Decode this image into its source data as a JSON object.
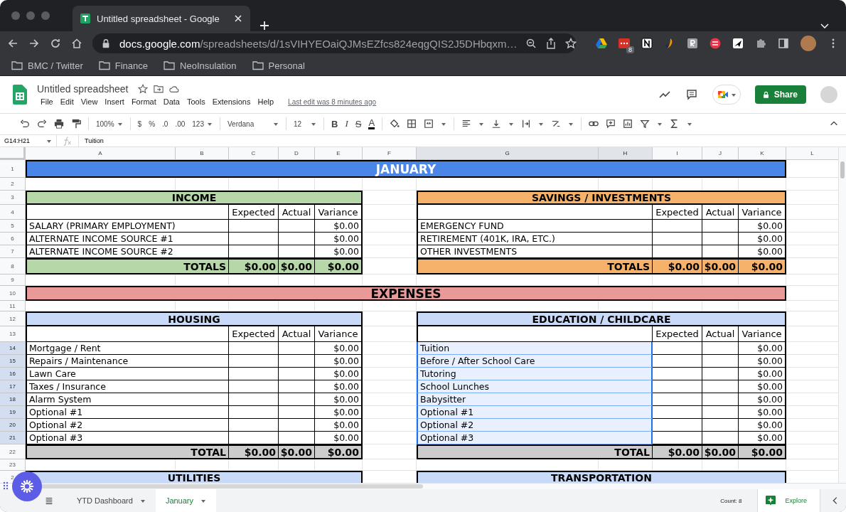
{
  "browser": {
    "tabs": [
      {
        "title": "Untitled spreadsheet - Google",
        "selected": true
      }
    ],
    "url": {
      "domain": "docs.google.com",
      "path": "/spreadsheets/d/1sVIHYEOaiQJMsEZfcs824eqgQIS2J5DHbqxm…"
    },
    "extension_badge": "8",
    "bookmarks": [
      "BMC / Twitter",
      "Finance",
      "NeoInsulation",
      "Personal"
    ]
  },
  "app": {
    "title": "Untitled spreadsheet",
    "menu": [
      "File",
      "Edit",
      "View",
      "Insert",
      "Format",
      "Data",
      "Tools",
      "Extensions",
      "Help"
    ],
    "last_edit": "Last edit was 8 minutes ago",
    "share": "Share"
  },
  "toolbar": {
    "zoom": "100%",
    "currency": "$",
    "percent": "%",
    "decrease_decimals": ".0",
    "increase_decimals": ".00",
    "more_formats": "123",
    "font": "Verdana",
    "font_size": "12",
    "bold": "B",
    "italic": "I",
    "strikethrough": "S",
    "text_color": "A"
  },
  "formula_bar": {
    "name_box": "G14:H21",
    "formula": "Tuition"
  },
  "sheet": {
    "columns": [
      {
        "label": "A",
        "selected": false
      },
      {
        "label": "B",
        "selected": false
      },
      {
        "label": "C",
        "selected": false
      },
      {
        "label": "D",
        "selected": false
      },
      {
        "label": "E",
        "selected": false
      },
      {
        "label": "F",
        "selected": false
      },
      {
        "label": "G",
        "selected": true
      },
      {
        "label": "H",
        "selected": true
      },
      {
        "label": "I",
        "selected": false
      },
      {
        "label": "J",
        "selected": false
      },
      {
        "label": "K",
        "selected": false
      },
      {
        "label": "L",
        "selected": false
      }
    ],
    "rows": [
      {
        "label": "1",
        "selected": false
      },
      {
        "label": "2",
        "selected": false
      },
      {
        "label": "3",
        "selected": false
      },
      {
        "label": "4",
        "selected": false
      },
      {
        "label": "5",
        "selected": false
      },
      {
        "label": "6",
        "selected": false
      },
      {
        "label": "7",
        "selected": false
      },
      {
        "label": "8",
        "selected": false
      },
      {
        "label": "9",
        "selected": false
      },
      {
        "label": "10",
        "selected": false
      },
      {
        "label": "11",
        "selected": false
      },
      {
        "label": "12",
        "selected": false
      },
      {
        "label": "13",
        "selected": false
      },
      {
        "label": "14",
        "selected": true
      },
      {
        "label": "15",
        "selected": true
      },
      {
        "label": "16",
        "selected": true
      },
      {
        "label": "17",
        "selected": true
      },
      {
        "label": "18",
        "selected": true
      },
      {
        "label": "19",
        "selected": true
      },
      {
        "label": "20",
        "selected": true
      },
      {
        "label": "21",
        "selected": true
      },
      {
        "label": "22",
        "selected": false
      },
      {
        "label": "23",
        "selected": false
      },
      {
        "label": "2",
        "selected": false
      }
    ],
    "blocks": [
      {
        "kind": "banner",
        "text": "JANUARY",
        "color": "#4a86e8"
      },
      {
        "kind": "pair",
        "tables": [
          {
            "title": "INCOME",
            "color": "#b6d7a8",
            "columns": [
              "Expected",
              "Actual",
              "Variance"
            ],
            "items": [
              {
                "label": "SALARY (PRIMARY EMPLOYMENT)",
                "variance": "$0.00",
                "selected": false
              },
              {
                "label": "ALTERNATE INCOME SOURCE #1",
                "variance": "$0.00",
                "selected": false
              },
              {
                "label": "ALTERNATE INCOME SOURCE #2",
                "variance": "$0.00",
                "selected": false
              }
            ],
            "total": {
              "label": "TOTALS",
              "color": "#b6d7a8",
              "values": [
                "$0.00",
                "$0.00",
                "$0.00"
              ]
            }
          },
          {
            "title": "SAVINGS / INVESTMENTS",
            "color": "#f6b26b",
            "columns": [
              "Expected",
              "Actual",
              "Variance"
            ],
            "items": [
              {
                "label": "EMERGENCY FUND",
                "variance": "$0.00",
                "selected": false
              },
              {
                "label": "RETIREMENT (401K, IRA, ETC.)",
                "variance": "$0.00",
                "selected": false
              },
              {
                "label": "OTHER INVESTMENTS",
                "variance": "$0.00",
                "selected": false
              }
            ],
            "total": {
              "label": "TOTALS",
              "color": "#f6b26b",
              "values": [
                "$0.00",
                "$0.00",
                "$0.00"
              ]
            }
          }
        ]
      },
      {
        "kind": "banner",
        "text": "EXPENSES",
        "color": "#ea9999"
      },
      {
        "kind": "pair",
        "tables": [
          {
            "title": "HOUSING",
            "color": "#c9daf8",
            "columns": [
              "Expected",
              "Actual",
              "Variance"
            ],
            "items": [
              {
                "label": "Mortgage / Rent",
                "variance": "$0.00",
                "selected": false
              },
              {
                "label": "Repairs / Maintenance",
                "variance": "$0.00",
                "selected": false
              },
              {
                "label": "Lawn Care",
                "variance": "$0.00",
                "selected": false
              },
              {
                "label": "Taxes / Insurance",
                "variance": "$0.00",
                "selected": false
              },
              {
                "label": "Alarm System",
                "variance": "$0.00",
                "selected": false
              },
              {
                "label": "Optional #1",
                "variance": "$0.00",
                "selected": false
              },
              {
                "label": "Optional #2",
                "variance": "$0.00",
                "selected": false
              },
              {
                "label": "Optional #3",
                "variance": "$0.00",
                "selected": false
              }
            ],
            "total": {
              "label": "TOTAL",
              "color": "#cccccc",
              "values": [
                "$0.00",
                "$0.00",
                "$0.00"
              ]
            }
          },
          {
            "title": "EDUCATION / CHILDCARE",
            "color": "#c9daf8",
            "columns": [
              "Expected",
              "Actual",
              "Variance"
            ],
            "items": [
              {
                "label": "Tuition",
                "variance": "$0.00",
                "selected": true
              },
              {
                "label": "Before / After School Care",
                "variance": "$0.00",
                "selected": true
              },
              {
                "label": "Tutoring",
                "variance": "$0.00",
                "selected": true
              },
              {
                "label": "School Lunches",
                "variance": "$0.00",
                "selected": true
              },
              {
                "label": "Babysitter",
                "variance": "$0.00",
                "selected": true
              },
              {
                "label": "Optional #1",
                "variance": "$0.00",
                "selected": true
              },
              {
                "label": "Optional #2",
                "variance": "$0.00",
                "selected": true
              },
              {
                "label": "Optional #3",
                "variance": "$0.00",
                "selected": true
              }
            ],
            "total": {
              "label": "TOTAL",
              "color": "#cccccc",
              "values": [
                "$0.00",
                "$0.00",
                "$0.00"
              ]
            }
          }
        ]
      },
      {
        "kind": "pair",
        "tables": [
          {
            "title": "UTILITIES",
            "color": "#c9daf8"
          },
          {
            "title": "TRANSPORTATION",
            "color": "#c9daf8"
          }
        ]
      }
    ]
  },
  "sheet_tabs": [
    {
      "label": "YTD Dashboard",
      "selected": false
    },
    {
      "label": "January",
      "selected": true
    }
  ],
  "status": {
    "count": "Count: 8",
    "explore": "Explore"
  }
}
